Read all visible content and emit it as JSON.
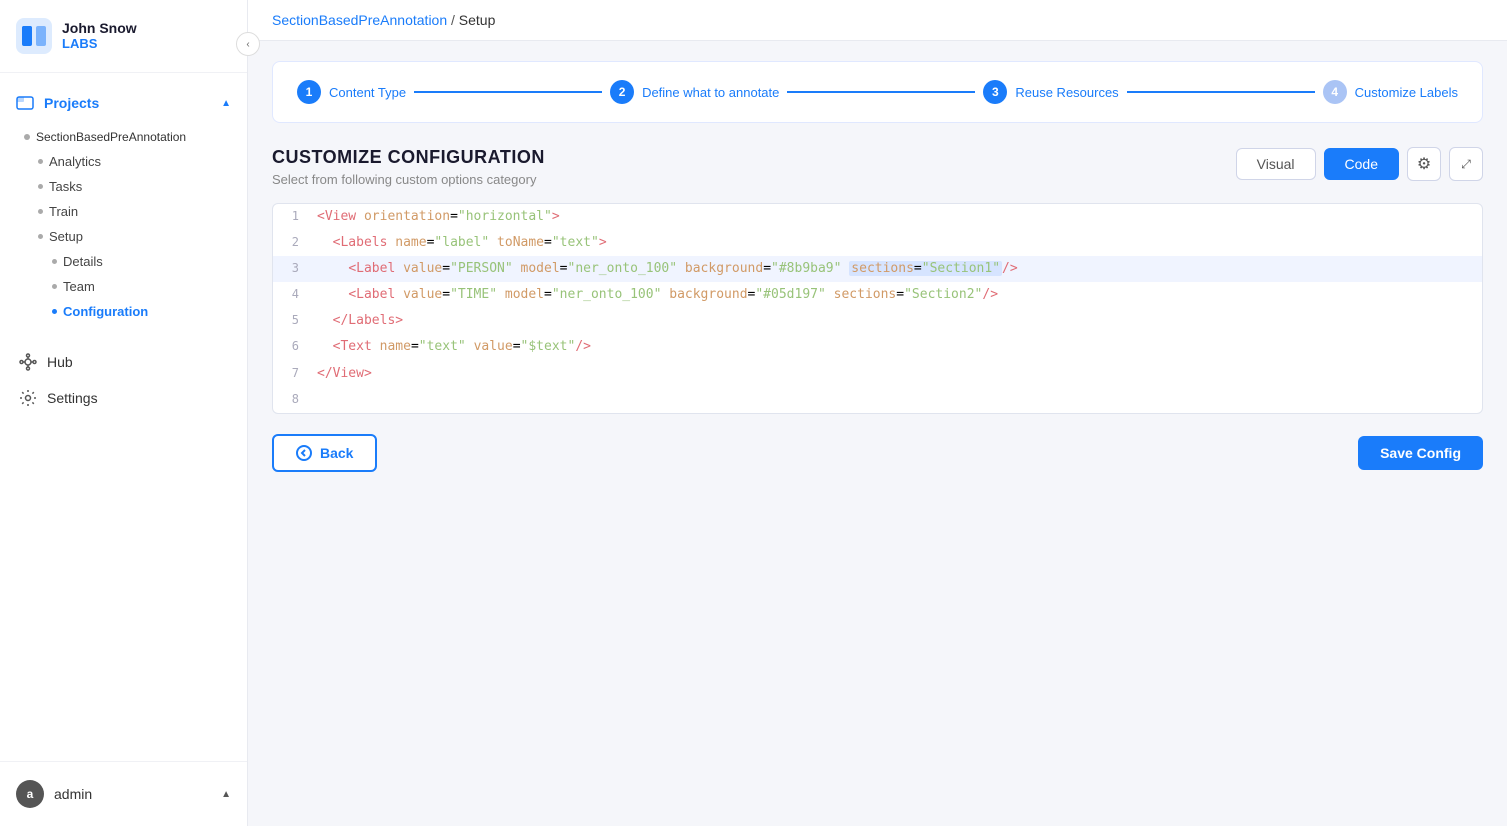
{
  "app": {
    "logo_line1": "John Snow",
    "logo_line2": "LABS"
  },
  "sidebar": {
    "collapse_icon": "‹",
    "projects_label": "Projects",
    "projects_chevron": "▲",
    "project_name": "SectionBasedPreAnnotation",
    "nav_items": [
      {
        "id": "analytics",
        "label": "Analytics"
      },
      {
        "id": "tasks",
        "label": "Tasks"
      },
      {
        "id": "train",
        "label": "Train"
      },
      {
        "id": "setup",
        "label": "Setup"
      }
    ],
    "setup_children": [
      {
        "id": "details",
        "label": "Details"
      },
      {
        "id": "team",
        "label": "Team"
      },
      {
        "id": "configuration",
        "label": "Configuration",
        "active": true
      }
    ],
    "hub_label": "Hub",
    "settings_label": "Settings",
    "user": {
      "avatar": "a",
      "name": "admin",
      "chevron": "▲"
    }
  },
  "breadcrumb": {
    "project": "SectionBasedPreAnnotation",
    "sep": "/",
    "current": "Setup"
  },
  "steps": [
    {
      "num": "1",
      "label": "Content Type"
    },
    {
      "num": "2",
      "label": "Define what to annotate"
    },
    {
      "num": "3",
      "label": "Reuse Resources"
    },
    {
      "num": "4",
      "label": "Customize Labels"
    }
  ],
  "config": {
    "title": "CUSTOMIZE CONFIGURATION",
    "subtitle": "Select from following custom options category",
    "visual_label": "Visual",
    "code_label": "Code",
    "settings_icon": "⚙",
    "expand_icon": "⤢"
  },
  "code_lines": [
    {
      "num": 1,
      "content": "<View orientation=\"horizontal\">"
    },
    {
      "num": 2,
      "content": "  <Labels name=\"label\" toName=\"text\">"
    },
    {
      "num": 3,
      "content": "    <Label value=\"PERSON\" model=\"ner_onto_100\" background=\"#8b9ba9\" sections=\"Section1\"/>",
      "highlight_start": 57,
      "highlight_end": 81
    },
    {
      "num": 4,
      "content": "    <Label value=\"TIME\" model=\"ner_onto_100\" background=\"#05d197\" sections=\"Section2\"/>"
    },
    {
      "num": 5,
      "content": "  </Labels>"
    },
    {
      "num": 6,
      "content": "  <Text name=\"text\" value=\"$text\"/>"
    },
    {
      "num": 7,
      "content": "</View>"
    },
    {
      "num": 8,
      "content": ""
    }
  ],
  "actions": {
    "back_label": "Back",
    "save_label": "Save Config"
  }
}
